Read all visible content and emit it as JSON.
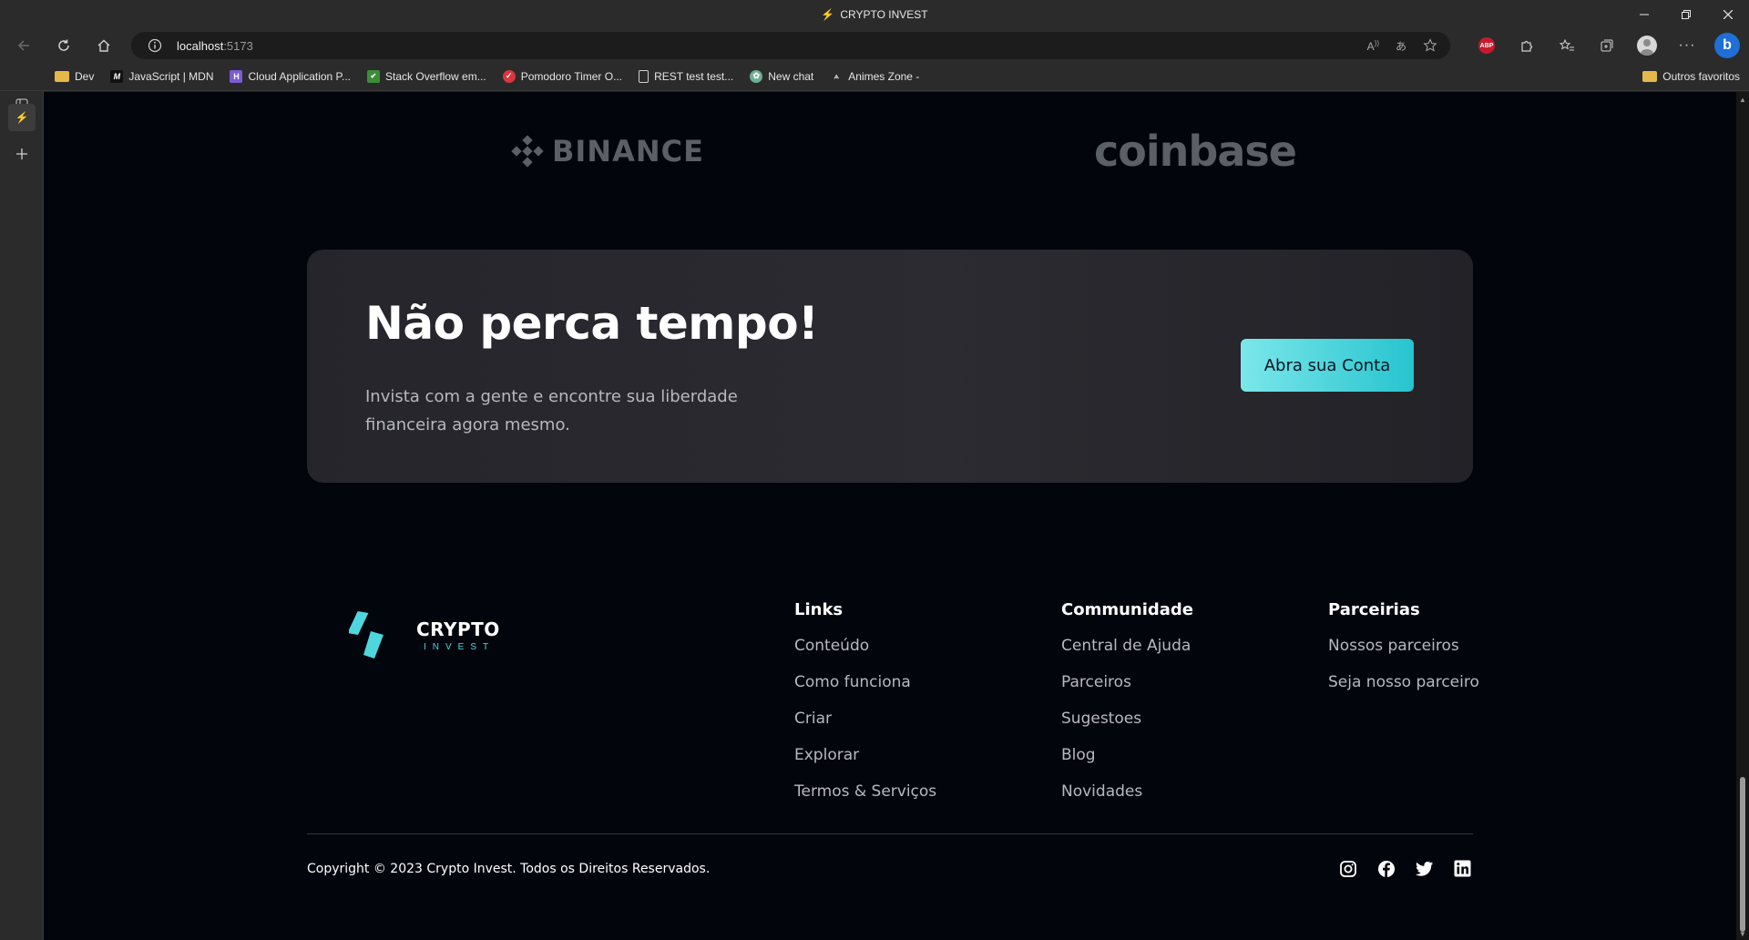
{
  "window": {
    "title": "CRYPTO INVEST"
  },
  "toolbar": {
    "url_host": "localhost",
    "url_port": ":5173",
    "abp_label": "ABP"
  },
  "bookmarks": {
    "items": [
      {
        "label": "Dev",
        "icon": "folder-icon"
      },
      {
        "label": "JavaScript | MDN",
        "icon": "mdn-icon"
      },
      {
        "label": "Cloud Application P...",
        "icon": "heroku-icon"
      },
      {
        "label": "Stack Overflow em...",
        "icon": "page-icon"
      },
      {
        "label": "Pomodoro Timer O...",
        "icon": "check-icon"
      },
      {
        "label": "REST test test...",
        "icon": "document-icon"
      },
      {
        "label": "New chat",
        "icon": "chatgpt-icon"
      },
      {
        "label": "Animes Zone -",
        "icon": "anime-icon"
      }
    ],
    "other": "Outros favoritos"
  },
  "partners": {
    "binance": "BINANCE",
    "coinbase": "coinbase"
  },
  "cta": {
    "title": "Não perca tempo!",
    "text": "Invista com a gente e encontre sua liberdade financeira agora mesmo.",
    "button": "Abra sua Conta"
  },
  "footer": {
    "brand": {
      "name": "CRYPTO",
      "sub": "INVEST"
    },
    "columns": [
      {
        "title": "Links",
        "items": [
          "Conteúdo",
          "Como funciona",
          "Criar",
          "Explorar",
          "Termos & Serviços"
        ]
      },
      {
        "title": "Communidade",
        "items": [
          "Central de Ajuda",
          "Parceiros",
          "Sugestoes",
          "Blog",
          "Novidades"
        ]
      },
      {
        "title": "Parceirias",
        "items": [
          "Nossos parceiros",
          "Seja nosso parceiro"
        ]
      }
    ],
    "copyright": "Copyright © 2023 Crypto Invest. Todos os Direitos Reservados.",
    "social": [
      "instagram-icon",
      "facebook-icon",
      "twitter-icon",
      "linkedin-icon"
    ]
  },
  "colors": {
    "accent": "#27c4cf",
    "background": "#03050d",
    "card": "#28282e"
  }
}
